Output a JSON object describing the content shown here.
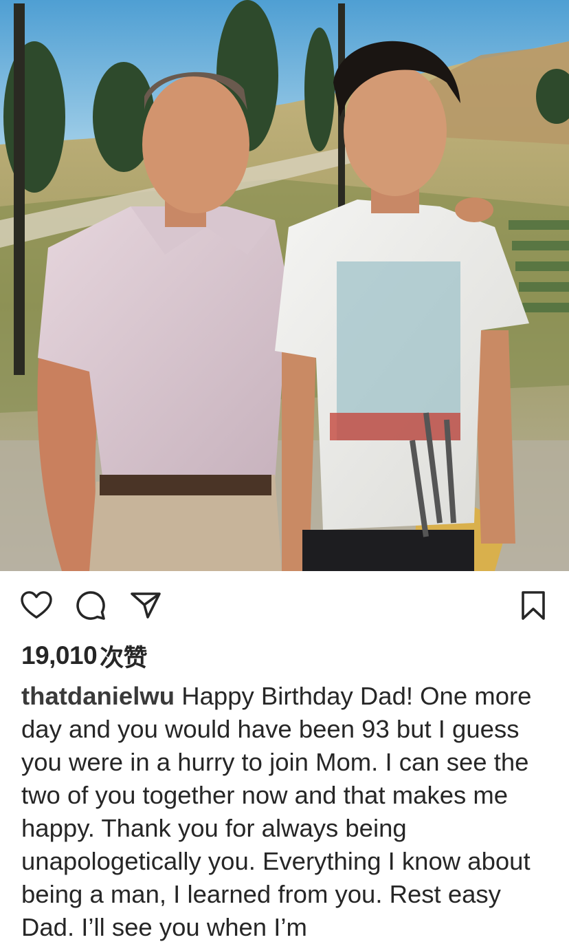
{
  "post": {
    "image_alt": "Photo of an older man in a pink polo shirt standing beside a teenage boy in a graphic t-shirt on a golf course",
    "actions": {
      "like_icon": "heart-outline-icon",
      "comment_icon": "comment-bubble-icon",
      "share_icon": "paper-plane-icon",
      "save_icon": "bookmark-outline-icon"
    },
    "likes": {
      "count": "19,010",
      "suffix": "次赞"
    },
    "caption": {
      "username": "thatdanielwu",
      "text": "Happy Birthday Dad! One more day and you would have been 93 but I guess you were in a hurry to join Mom. I can see the two of you together now and that makes me happy. Thank you for always being unapologetically you. Everything I know about being a man, I learned from you. Rest easy Dad.  I’ll see you when I’m"
    }
  },
  "colors": {
    "text": "#262626",
    "background": "#ffffff",
    "icon": "#262626"
  }
}
